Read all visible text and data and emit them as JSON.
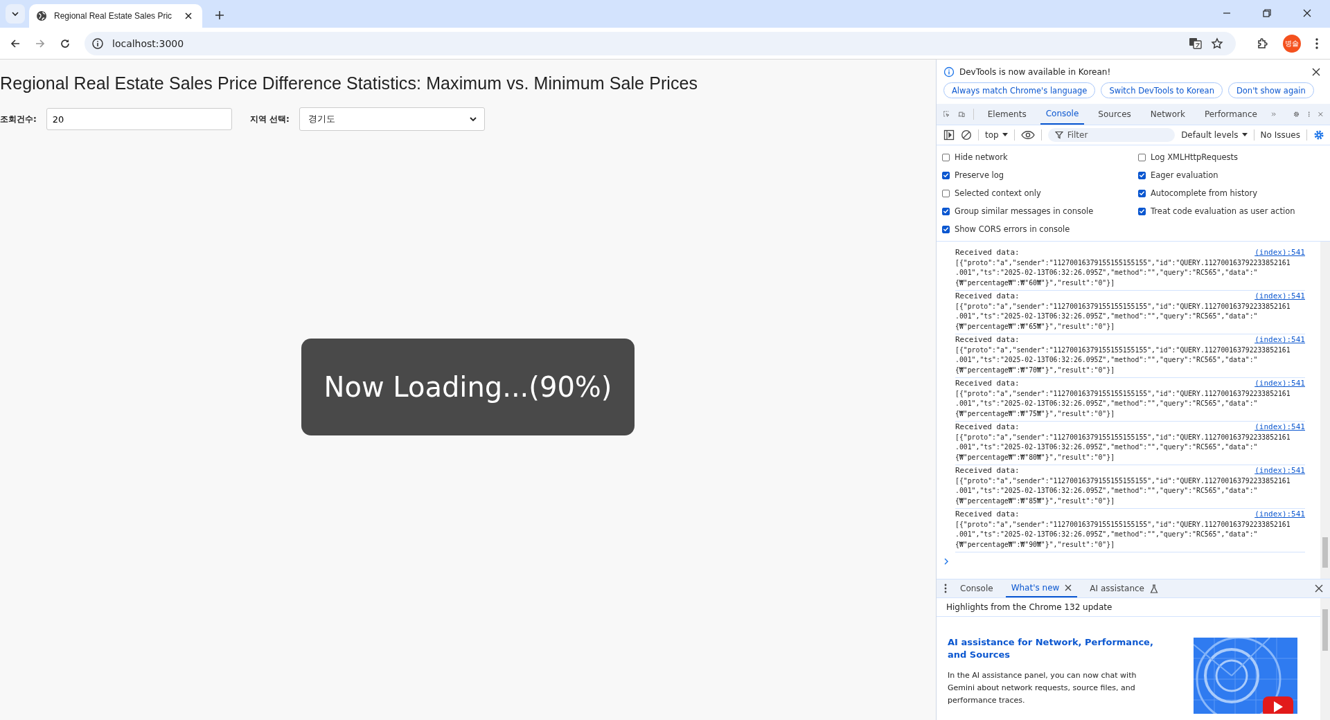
{
  "browser": {
    "tab": {
      "title": "Regional Real Estate Sales Pric"
    },
    "address": "localhost:3000",
    "profile_initials": "병술"
  },
  "page": {
    "title": "Regional Real Estate Sales Price Difference Statistics: Maximum vs. Minimum Sale Prices",
    "fields": [
      {
        "label": "조회건수:",
        "value": "20",
        "kind": "input"
      },
      {
        "label": "지역 선택:",
        "value": "경기도",
        "kind": "select"
      }
    ],
    "loading": "Now Loading...(90%)"
  },
  "devtools": {
    "infobar": {
      "message": "DevTools is now available in Korean!",
      "buttons": [
        "Always match Chrome's language",
        "Switch DevTools to Korean",
        "Don't show again"
      ]
    },
    "tabs": [
      {
        "label": "Elements",
        "selected": false
      },
      {
        "label": "Console",
        "selected": true
      },
      {
        "label": "Sources",
        "selected": false
      },
      {
        "label": "Network",
        "selected": false
      },
      {
        "label": "Performance",
        "selected": false
      }
    ],
    "toolbar": {
      "context": "top",
      "filter_placeholder": "Filter",
      "levels": "Default levels",
      "issues": "No Issues"
    },
    "settings": [
      {
        "label": "Hide network",
        "checked": false
      },
      {
        "label": "Log XMLHttpRequests",
        "checked": false
      },
      {
        "label": "Preserve log",
        "checked": true
      },
      {
        "label": "Eager evaluation",
        "checked": true
      },
      {
        "label": "Selected context only",
        "checked": false
      },
      {
        "label": "Autocomplete from history",
        "checked": true
      },
      {
        "label": "Group similar messages in console",
        "checked": true
      },
      {
        "label": "Treat code evaluation as user action",
        "checked": true
      },
      {
        "label": "Show CORS errors in console",
        "checked": true
      }
    ],
    "messages": [
      {
        "text": "Received data:",
        "body": "[{\"proto\":\"a\",\"sender\":\"11270016379155155155155\",\"id\":\"QUERY.112700163792233852161.001\",\"ts\":\"2025-02-13T06:32:26.095Z\",\"method\":\"\",\"query\":\"RC565\",\"data\":\"{₩\"percentage₩\":₩\"60₩\"}\",\"result\":\"0\"}]",
        "source": "(index):541"
      },
      {
        "text": "Received data:",
        "body": "[{\"proto\":\"a\",\"sender\":\"11270016379155155155155\",\"id\":\"QUERY.112700163792233852161.001\",\"ts\":\"2025-02-13T06:32:26.095Z\",\"method\":\"\",\"query\":\"RC565\",\"data\":\"{₩\"percentage₩\":₩\"65₩\"}\",\"result\":\"0\"}]",
        "source": "(index):541"
      },
      {
        "text": "Received data:",
        "body": "[{\"proto\":\"a\",\"sender\":\"11270016379155155155155\",\"id\":\"QUERY.112700163792233852161.001\",\"ts\":\"2025-02-13T06:32:26.095Z\",\"method\":\"\",\"query\":\"RC565\",\"data\":\"{₩\"percentage₩\":₩\"70₩\"}\",\"result\":\"0\"}]",
        "source": "(index):541"
      },
      {
        "text": "Received data:",
        "body": "[{\"proto\":\"a\",\"sender\":\"11270016379155155155155\",\"id\":\"QUERY.112700163792233852161.001\",\"ts\":\"2025-02-13T06:32:26.095Z\",\"method\":\"\",\"query\":\"RC565\",\"data\":\"{₩\"percentage₩\":₩\"75₩\"}\",\"result\":\"0\"}]",
        "source": "(index):541"
      },
      {
        "text": "Received data:",
        "body": "[{\"proto\":\"a\",\"sender\":\"11270016379155155155155\",\"id\":\"QUERY.112700163792233852161.001\",\"ts\":\"2025-02-13T06:32:26.095Z\",\"method\":\"\",\"query\":\"RC565\",\"data\":\"{₩\"percentage₩\":₩\"80₩\"}\",\"result\":\"0\"}]",
        "source": "(index):541"
      },
      {
        "text": "Received data:",
        "body": "[{\"proto\":\"a\",\"sender\":\"11270016379155155155155\",\"id\":\"QUERY.112700163792233852161.001\",\"ts\":\"2025-02-13T06:32:26.095Z\",\"method\":\"\",\"query\":\"RC565\",\"data\":\"{₩\"percentage₩\":₩\"85₩\"}\",\"result\":\"0\"}]",
        "source": "(index):541"
      },
      {
        "text": "Received data:",
        "body": "[{\"proto\":\"a\",\"sender\":\"11270016379155155155155\",\"id\":\"QUERY.112700163792233852161.001\",\"ts\":\"2025-02-13T06:32:26.095Z\",\"method\":\"\",\"query\":\"RC565\",\"data\":\"{₩\"percentage₩\":₩\"90₩\"}\",\"result\":\"0\"}]",
        "source": "(index):541"
      }
    ],
    "drawer": {
      "tabs": [
        {
          "label": "Console",
          "selected": false,
          "closable": false,
          "experimental": false
        },
        {
          "label": "What's new",
          "selected": true,
          "closable": true,
          "experimental": false
        },
        {
          "label": "AI assistance",
          "selected": false,
          "closable": false,
          "experimental": true
        }
      ],
      "subtitle": "Highlights from the Chrome 132 update",
      "heading": "AI assistance for Network, Performance, and Sources",
      "body": "In the AI assistance panel, you can now chat with Gemini about network requests, source files, and performance traces."
    }
  }
}
